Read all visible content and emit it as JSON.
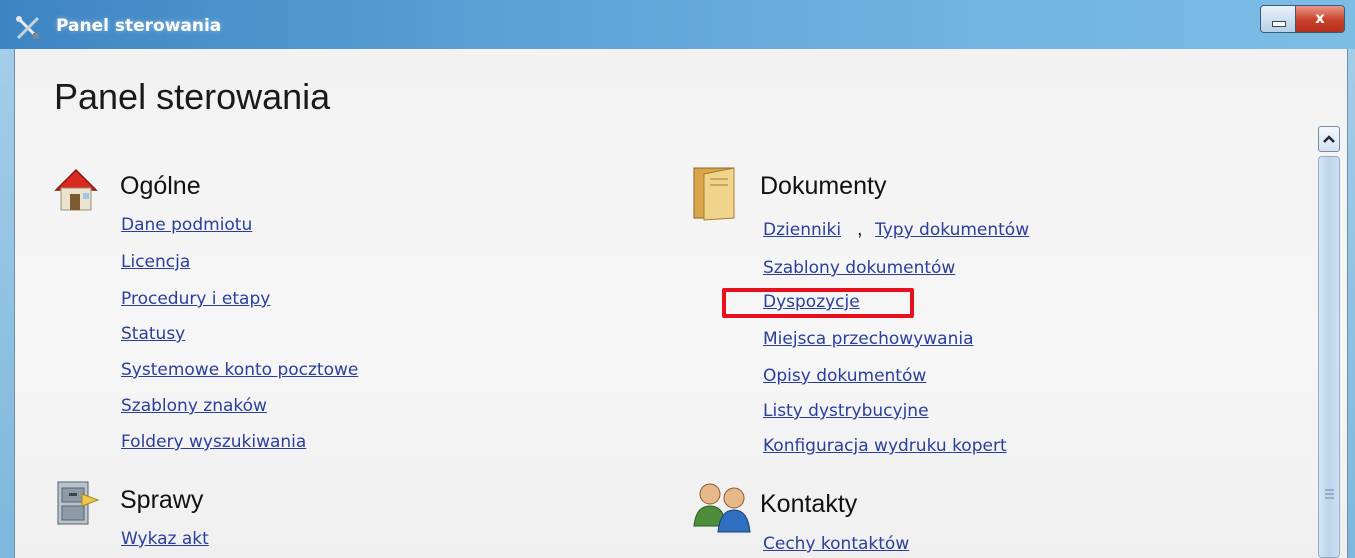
{
  "window": {
    "title": "Panel sterowania",
    "icons": {
      "app": "tools-icon",
      "minimize": "minimize-icon",
      "close": "close-icon"
    },
    "close_label": "x"
  },
  "page": {
    "title": "Panel sterowania"
  },
  "sections": {
    "ogolne": {
      "title": "Ogólne",
      "icon": "house-icon",
      "links": [
        "Dane podmiotu",
        "Licencja",
        "Procedury i etapy",
        "Statusy",
        "Systemowe konto pocztowe",
        "Szablony znaków",
        "Foldery wyszukiwania"
      ]
    },
    "sprawy": {
      "title": "Sprawy",
      "icon": "cabinet-icon",
      "links": [
        "Wykaz akt"
      ]
    },
    "dokumenty": {
      "title": "Dokumenty",
      "icon": "folder-icon",
      "links": [
        "Dzienniki",
        "Typy dokumentów",
        "Szablony dokumentów",
        "Dyspozycje",
        "Miejsca przechowywania",
        "Opisy dokumentów",
        "Listy dystrybucyjne",
        "Konfiguracja wydruku kopert"
      ],
      "separator": ","
    },
    "kontakty": {
      "title": "Kontakty",
      "icon": "people-icon",
      "links": [
        "Cechy kontaktów"
      ]
    }
  },
  "annotation": {
    "color": "#e8101c",
    "target": "Dyspozycje"
  },
  "colors": {
    "link": "#2a3f9c",
    "titlebar": "#5aa0d5"
  }
}
